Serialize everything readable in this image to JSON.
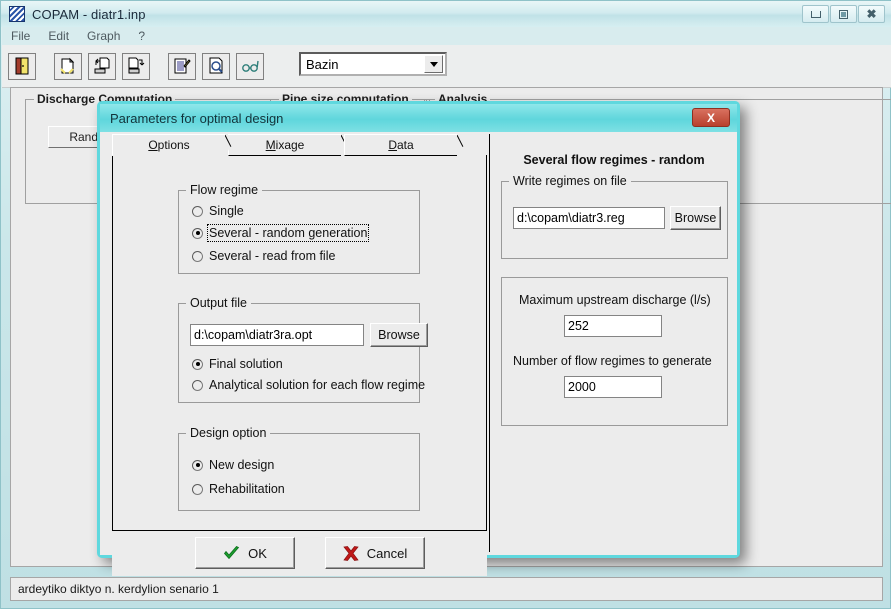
{
  "window": {
    "title": "COPAM - diatr1.inp",
    "icon": "app-icon",
    "minimize_label": "Minimize",
    "maximize_label": "Maximize",
    "close_label": "Close"
  },
  "menu": {
    "items": [
      {
        "label": "File"
      },
      {
        "label": "Edit"
      },
      {
        "label": "Graph"
      },
      {
        "label": "?"
      }
    ]
  },
  "toolbar": {
    "buttons": [
      {
        "name": "exit-icon",
        "tip": "Exit"
      },
      {
        "name": "new-file-icon",
        "tip": "New"
      },
      {
        "name": "open-file-icon",
        "tip": "Open"
      },
      {
        "name": "save-file-icon",
        "tip": "Save"
      },
      {
        "name": "edit-data-icon",
        "tip": "Edit data"
      },
      {
        "name": "print-preview-icon",
        "tip": "Preview"
      },
      {
        "name": "view-glasses-icon",
        "tip": "View"
      }
    ],
    "method_combo": {
      "value": "Bazin",
      "options": [
        "Bazin"
      ]
    }
  },
  "background": {
    "groups": [
      {
        "label": "Discharge Computation"
      },
      {
        "label": "Pipe size computation"
      },
      {
        "label": "Analysis"
      }
    ],
    "random_button": "Random"
  },
  "statusbar": {
    "text": "ardeytiko diktyo n. kerdylion senario 1"
  },
  "dialog": {
    "title": "Parameters for optimal design",
    "close_label": "X",
    "tabs": [
      {
        "label_pre": "",
        "label_accel": "O",
        "label_post": "ptions",
        "label": "Options",
        "active": true
      },
      {
        "label_pre": "",
        "label_accel": "M",
        "label_post": "ixage",
        "label": "Mixage",
        "active": false
      },
      {
        "label_pre": "",
        "label_accel": "D",
        "label_post": "ata",
        "label": "Data",
        "active": false
      }
    ],
    "flow_regime": {
      "title": "Flow regime",
      "options": [
        {
          "label": "Single",
          "selected": false,
          "focused": false
        },
        {
          "label": "Several  - random generation",
          "selected": true,
          "focused": true
        },
        {
          "label": "Several  - read from file",
          "selected": false,
          "focused": false
        }
      ]
    },
    "output_file": {
      "title": "Output file",
      "path_value": "d:\\copam\\diatr3ra.opt",
      "browse_label": "Browse",
      "options": [
        {
          "label": "Final solution",
          "selected": true
        },
        {
          "label": "Analytical solution for each flow regime",
          "selected": false
        }
      ]
    },
    "design_option": {
      "title": "Design option",
      "options": [
        {
          "label": "New design",
          "selected": true
        },
        {
          "label": "Rehabilitation",
          "selected": false
        }
      ]
    },
    "buttons": {
      "ok": "OK",
      "cancel": "Cancel",
      "ok_icon": "check-icon",
      "cancel_icon": "x-icon"
    },
    "right_pane": {
      "heading": "Several flow regimes - random",
      "write_regimes": {
        "title": "Write regimes on file",
        "path_value": "d:\\copam\\diatr3.reg",
        "browse_label": "Browse"
      },
      "max_discharge": {
        "label": "Maximum upstream discharge (l/s)",
        "value": "252"
      },
      "num_regimes": {
        "label": "Number of flow regimes to generate",
        "value": "2000"
      }
    }
  },
  "colors": {
    "dialog_border": "#5fd8de",
    "dialog_titlebar": "#5fd6dc",
    "close_button": "#b8402c",
    "window_bg": "#ececec",
    "check_green": "#1c9e2e",
    "x_red": "#c01818"
  }
}
